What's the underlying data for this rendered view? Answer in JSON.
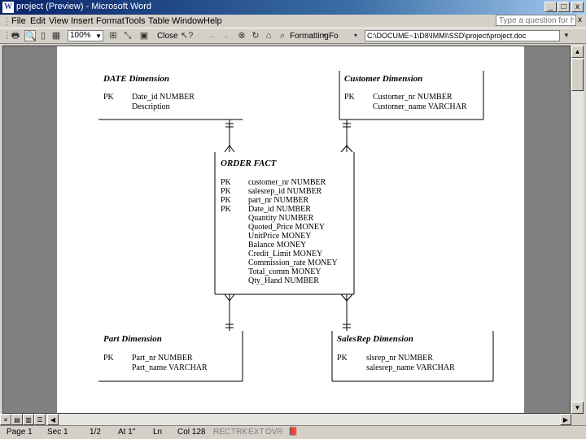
{
  "window": {
    "title": "project (Preview) - Microsoft Word",
    "app_icon": "W",
    "minimize": "_",
    "maximize": "□",
    "close": "x"
  },
  "menu": {
    "items": [
      "File",
      "Edit",
      "View",
      "Insert",
      "Format",
      "Tools",
      "Table",
      "Window",
      "Help"
    ],
    "help_placeholder": "Type a question for help",
    "help_close": "x"
  },
  "toolbar": {
    "zoom": "100%",
    "close_label": "Close",
    "formatting_label": "Formatting",
    "font_label": "Fo",
    "file_path": "C:\\DOCUME~1\\D8\\IMMI\\SSD\\project\\project.doc"
  },
  "diagram": {
    "entities": [
      {
        "title": "DATE Dimension",
        "rows": [
          {
            "key": "PK",
            "field": "Date_id NUMBER"
          },
          {
            "key": "",
            "field": "Description"
          }
        ]
      },
      {
        "title": "Customer Dimension",
        "rows": [
          {
            "key": "PK",
            "field": "Customer_nr NUMBER"
          },
          {
            "key": "",
            "field": "Customer_name VARCHAR"
          }
        ]
      },
      {
        "title": "ORDER FACT",
        "rows": [
          {
            "key": "PK",
            "field": "customer_nr NUMBER"
          },
          {
            "key": "PK",
            "field": "salesrep_id NUMBER"
          },
          {
            "key": "PK",
            "field": "part_nr NUMBER"
          },
          {
            "key": "PK",
            "field": "Date_id NUMBER"
          },
          {
            "key": "",
            "field": "Quantity NUMBER"
          },
          {
            "key": "",
            "field": "Quoted_Price MONEY"
          },
          {
            "key": "",
            "field": "UnitPrice MONEY"
          },
          {
            "key": "",
            "field": "Balance MONEY"
          },
          {
            "key": "",
            "field": "Credit_Limit MONEY"
          },
          {
            "key": "",
            "field": "Commission_rate MONEY"
          },
          {
            "key": "",
            "field": "Total_comm MONEY"
          },
          {
            "key": "",
            "field": "Qty_Hand NUMBER"
          }
        ]
      },
      {
        "title": "Part Dimension",
        "rows": [
          {
            "key": "PK",
            "field": "Part_nr NUMBER"
          },
          {
            "key": "",
            "field": "Part_name VARCHAR"
          }
        ]
      },
      {
        "title": "SalesRep Dimension",
        "rows": [
          {
            "key": "PK",
            "field": "slsrep_nr NUMBER"
          },
          {
            "key": "",
            "field": "salesrep_name VARCHAR"
          }
        ]
      }
    ]
  },
  "status": {
    "page": "Page 1",
    "sec": "Sec 1",
    "pages": "1/2",
    "at": "At 1\"",
    "ln": "Ln",
    "col": "Col 128",
    "rec": "REC",
    "trk": "TRK",
    "ext": "EXT",
    "ovr": "OVR"
  }
}
